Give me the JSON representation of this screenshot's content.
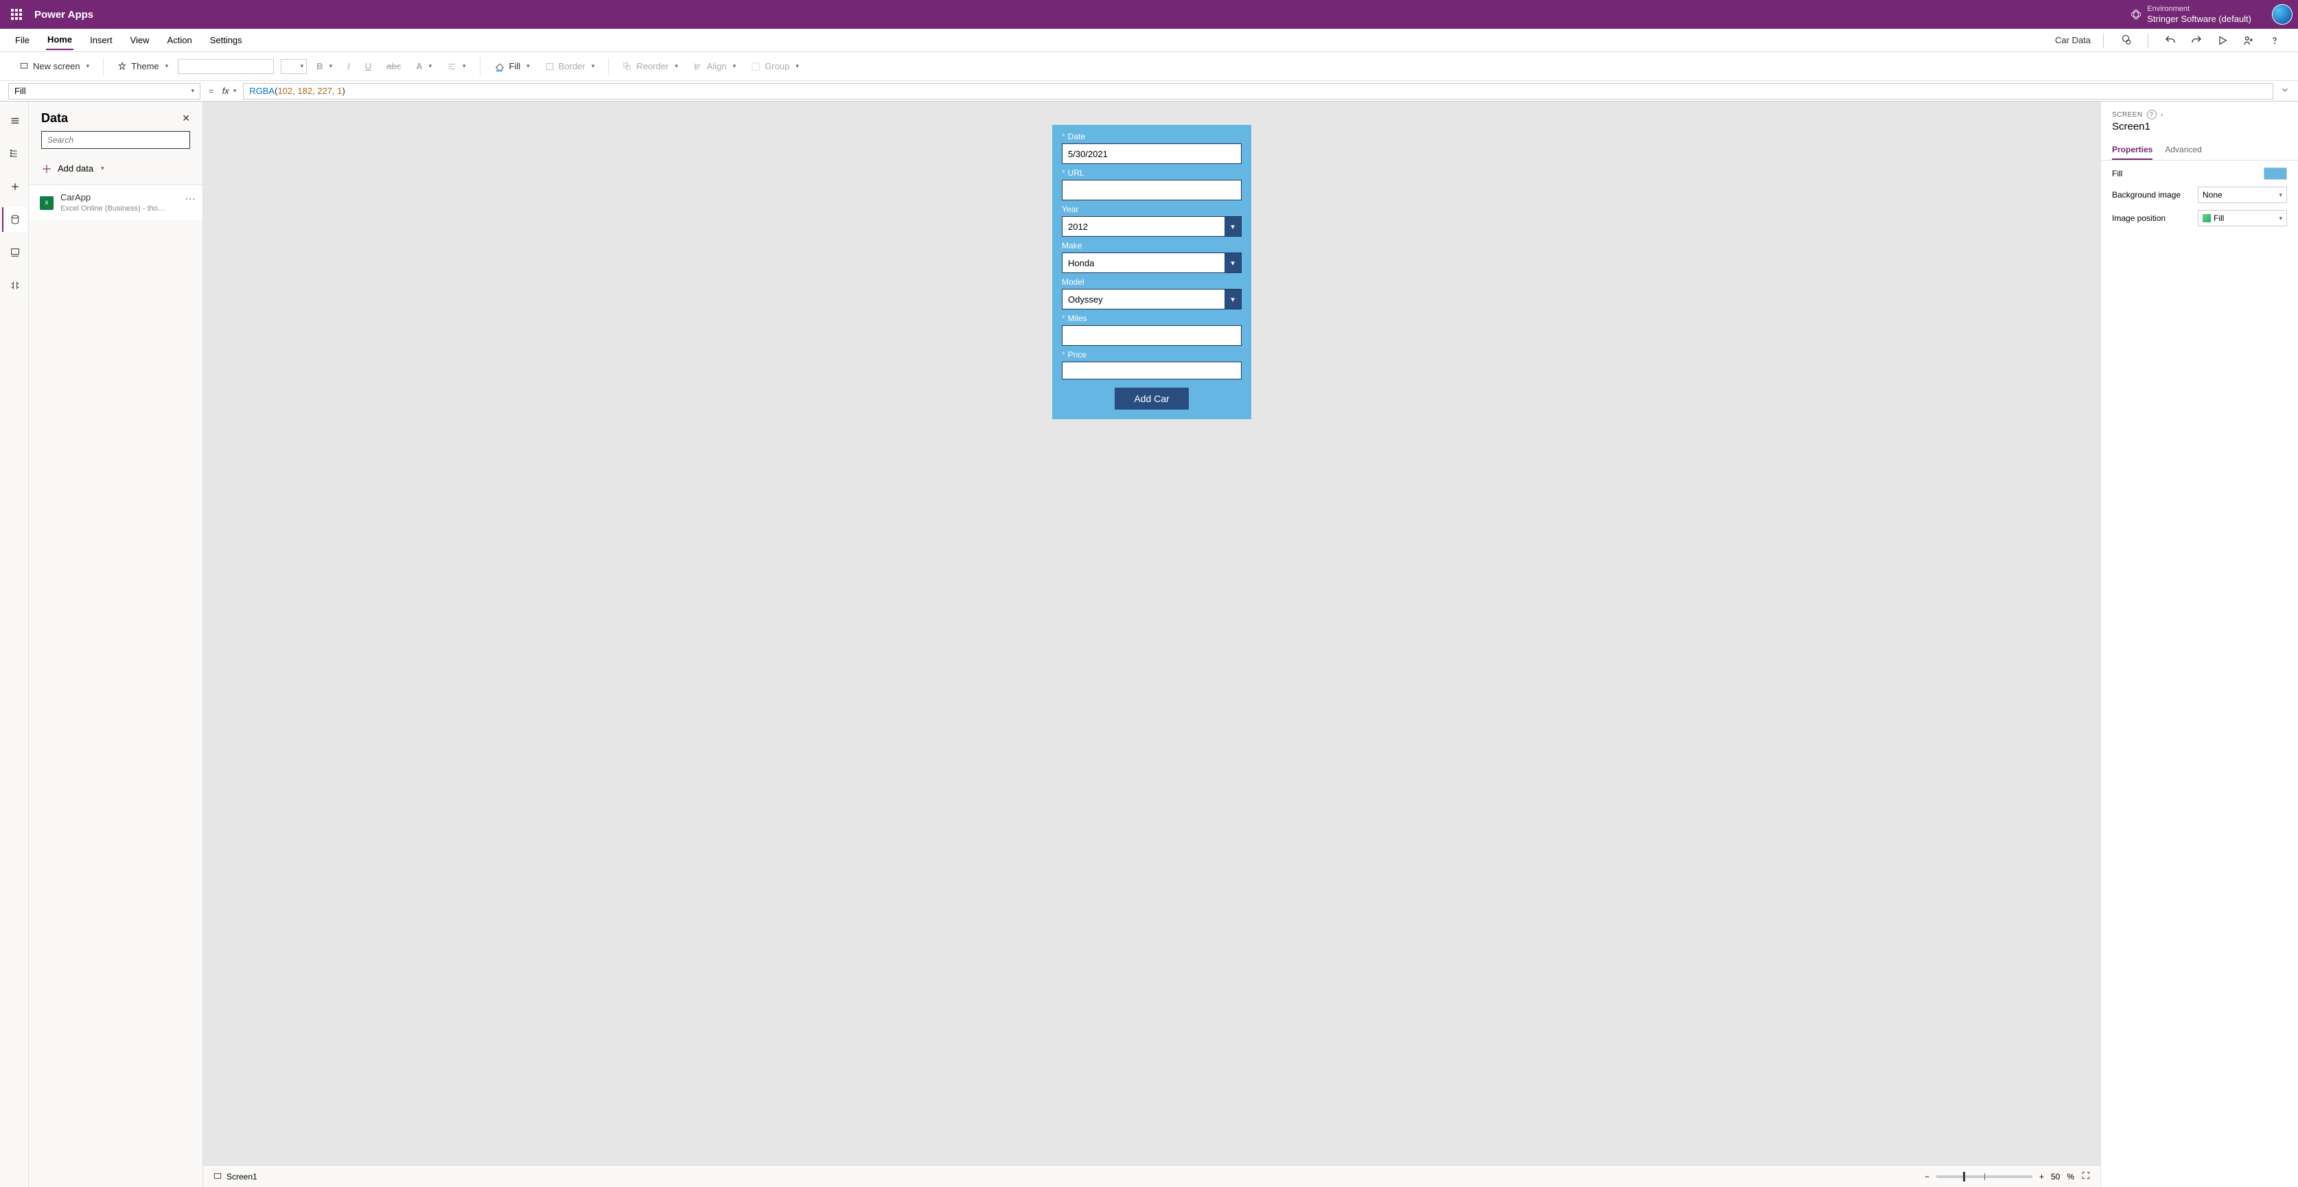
{
  "header": {
    "app_title": "Power Apps",
    "env_label": "Environment",
    "env_name": "Stringer Software (default)"
  },
  "menu": {
    "items": [
      "File",
      "Home",
      "Insert",
      "View",
      "Action",
      "Settings"
    ],
    "active_index": 1,
    "doc_name": "Car Data"
  },
  "ribbon": {
    "new_screen": "New screen",
    "theme": "Theme",
    "fill": "Fill",
    "border": "Border",
    "reorder": "Reorder",
    "align": "Align",
    "group": "Group"
  },
  "formula": {
    "property": "Fill",
    "fn": "RGBA",
    "args": [
      "102",
      "182",
      "227",
      "1"
    ]
  },
  "data_panel": {
    "title": "Data",
    "search_placeholder": "Search",
    "add_data": "Add data",
    "item_name": "CarApp",
    "item_sub": "Excel Online (Business) - thomas@trstri..."
  },
  "form": {
    "date_label": "Date",
    "date_value": "5/30/2021",
    "url_label": "URL",
    "url_value": "",
    "year_label": "Year",
    "year_value": "2012",
    "make_label": "Make",
    "make_value": "Honda",
    "model_label": "Model",
    "model_value": "Odyssey",
    "miles_label": "Miles",
    "miles_value": "",
    "price_label": "Price",
    "price_value": "",
    "submit": "Add Car"
  },
  "canvas_footer": {
    "screen": "Screen1",
    "zoom": "50",
    "pct": "%"
  },
  "rpanel": {
    "screen_lbl": "SCREEN",
    "name": "Screen1",
    "tab_props": "Properties",
    "tab_adv": "Advanced",
    "fill_lbl": "Fill",
    "bg_lbl": "Background image",
    "bg_val": "None",
    "pos_lbl": "Image position",
    "pos_val": "Fill"
  }
}
